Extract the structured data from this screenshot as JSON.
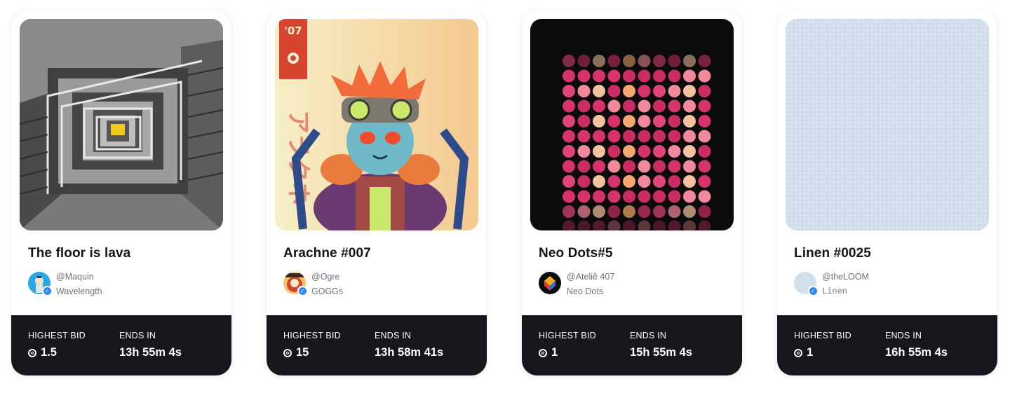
{
  "cards": [
    {
      "title": "The floor is lava",
      "creator_handle": "@Maquin",
      "collection": "Wavelength",
      "highest_bid_label": "HIGHEST BID",
      "highest_bid": "1.5",
      "ends_in_label": "ENDS IN",
      "ends_in": "13h 55m 4s"
    },
    {
      "title": "Arachne #007",
      "creator_handle": "@Ogre",
      "collection": "GOGGs",
      "highest_bid_label": "HIGHEST BID",
      "highest_bid": "15",
      "ends_in_label": "ENDS IN",
      "ends_in": "13h 58m 41s"
    },
    {
      "title": "Neo Dots#5",
      "creator_handle": "@Ateliê 407",
      "collection": "Neo Dots",
      "highest_bid_label": "HIGHEST BID",
      "highest_bid": "1",
      "ends_in_label": "ENDS IN",
      "ends_in": "15h 55m 4s"
    },
    {
      "title": "Linen #0025",
      "creator_handle": "@theLOOM",
      "collection": "Linen",
      "highest_bid_label": "HIGHEST BID",
      "highest_bid": "1",
      "ends_in_label": "ENDS IN",
      "ends_in": "16h 55m 4s"
    }
  ],
  "artwork_text": {
    "arachne_badge": "'07",
    "arachne_katakana": "アラクネ"
  },
  "icons": {
    "verified": "verified-check-icon",
    "currency": "eth-coin-icon"
  },
  "colors": {
    "footer_bg": "#16171c",
    "verified_blue": "#2f86f6",
    "muted_text": "#6f7280"
  }
}
